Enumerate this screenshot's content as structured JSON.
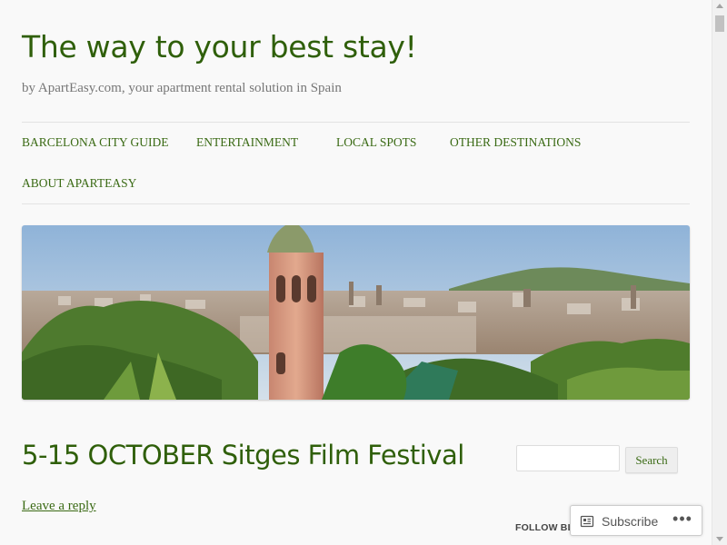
{
  "site": {
    "title": "The way to your best stay!",
    "tagline": "by ApartEasy.com, your apartment rental solution in Spain"
  },
  "nav": {
    "items": [
      {
        "label": "BARCELONA CITY GUIDE"
      },
      {
        "label": "ENTERTAINMENT"
      },
      {
        "label": "LOCAL SPOTS"
      },
      {
        "label": "OTHER DESTINATIONS"
      },
      {
        "label": "ABOUT APARTEASY"
      }
    ]
  },
  "post": {
    "title": "5-15 OCTOBER Sitges Film Festival",
    "reply_label": "Leave a reply"
  },
  "sidebar": {
    "search_placeholder": "",
    "search_button": "Search",
    "follow_heading": "FOLLOW BL"
  },
  "subscribe_bar": {
    "subscribe_label": "Subscribe",
    "more_label": "•••"
  },
  "colors": {
    "accent": "#2f5f0a",
    "link": "#3a6a14",
    "background": "#f9f9f9"
  },
  "icons": {
    "subscribe": "reader-icon",
    "more": "ellipsis-icon"
  }
}
